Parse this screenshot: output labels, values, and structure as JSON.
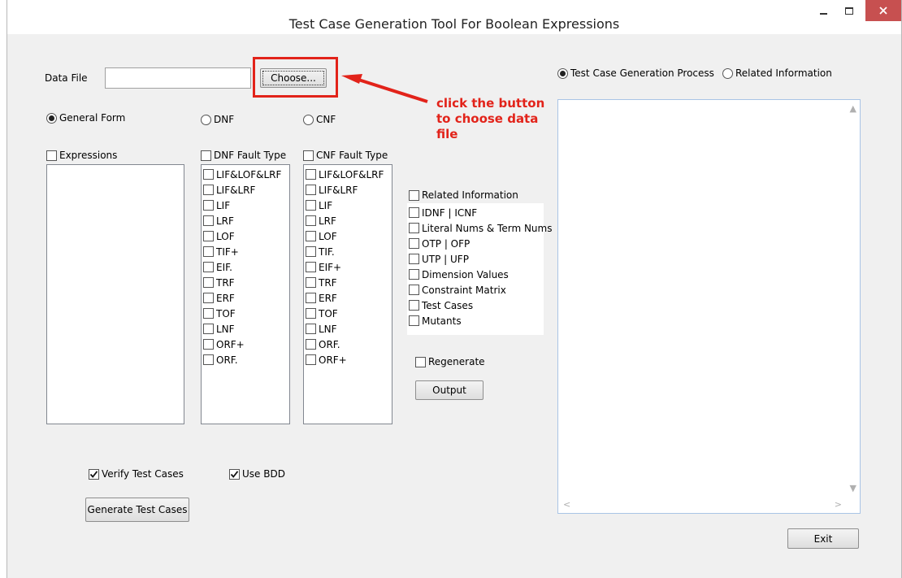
{
  "window": {
    "title": "Test Case Generation Tool  For Boolean Expressions"
  },
  "data_file": {
    "label": "Data File",
    "value": "",
    "choose_label": "Choose..."
  },
  "annotation": {
    "line1": "click the button",
    "line2": "to choose data",
    "line3": "file",
    "color": "#e2231a"
  },
  "forms": {
    "general": "General Form",
    "dnf": "DNF",
    "cnf": "CNF",
    "selected": "general"
  },
  "expressions": {
    "label": "Expressions"
  },
  "dnf_fault": {
    "label": "DNF Fault Type",
    "items": [
      "LIF&LOF&LRF",
      "LIF&LRF",
      "LIF",
      "LRF",
      "LOF",
      "TIF+",
      "EIF.",
      "TRF",
      "ERF",
      "TOF",
      "LNF",
      "ORF+",
      "ORF."
    ]
  },
  "cnf_fault": {
    "label": "CNF Fault Type",
    "items": [
      "LIF&LOF&LRF",
      "LIF&LRF",
      "LIF",
      "LRF",
      "LOF",
      "TIF.",
      "EIF+",
      "TRF",
      "ERF",
      "TOF",
      "LNF",
      "ORF.",
      "ORF+"
    ]
  },
  "related": {
    "label": "Related Information",
    "items": [
      "IDNF | ICNF",
      "Literal Nums & Term Nums",
      "OTP | OFP",
      "UTP | UFP",
      "Dimension Values",
      "Constraint Matrix",
      "Test Cases",
      "Mutants"
    ]
  },
  "regenerate": {
    "label": "Regenerate"
  },
  "output": {
    "label": "Output"
  },
  "verify": {
    "label": "Verify Test Cases",
    "checked": true
  },
  "use_bdd": {
    "label": "Use BDD",
    "checked": true
  },
  "generate": {
    "label": "Generate Test Cases"
  },
  "view": {
    "process": "Test Case Generation Process",
    "related": "Related Information",
    "selected": "process"
  },
  "exit": {
    "label": "Exit"
  }
}
